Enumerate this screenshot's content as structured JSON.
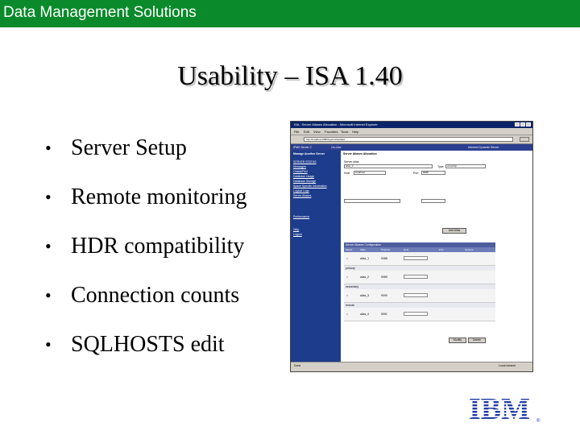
{
  "banner": {
    "text": "Data Management Solutions",
    "color": "#0a8a2a"
  },
  "slide": {
    "title": "Usability – ISA 1.40",
    "bullets": [
      "Server Setup",
      "Remote monitoring",
      "HDR compatibility",
      "Connection counts",
      "SQLHOSTS edit"
    ]
  },
  "logo": {
    "text": "IBM",
    "color": "#1f3aa8"
  },
  "screenshot": {
    "window_title": "ISA : Server Aliases Allocation - Microsoft Internet Explorer",
    "menu": [
      "File",
      "Edit",
      "View",
      "Favorites",
      "Tools",
      "Help"
    ],
    "address": "http://localhost:8080/cgi-bin/isa/alias",
    "header_left": "IFMX Server 2",
    "header_mid": "On-Line",
    "header_right": "Informix Dynamic Server",
    "sidebar_heading": "Manage Another Server",
    "sidebar_items": [
      "SERVER STATUS",
      "Messages",
      "Onstat/Perf",
      "Database Usage",
      "Database Storage",
      "Space Specific Information",
      "Logical Logs",
      "Server Aliases",
      "Performance",
      "Help",
      "Logout"
    ],
    "content_title": "Server Aliases Allocation",
    "field_labels": [
      "Server alias",
      "Type",
      "Host",
      "Port"
    ],
    "field_values": [
      "alias_2",
      "onsoctcp",
      "localhost",
      "9088"
    ],
    "add_button": "Add Alias",
    "table_title": "Server Aliases Configuration",
    "table_columns": [
      "Select",
      "Alias",
      "Protocol",
      "Host",
      "Port",
      "Options"
    ],
    "groups": [
      "primary",
      "secondary",
      "remote"
    ],
    "rows": [
      {
        "alias": "alias_1",
        "port": "9088"
      },
      {
        "alias": "alias_2",
        "port": "9089"
      },
      {
        "alias": "alias_3",
        "port": "9090"
      },
      {
        "alias": "alias_4",
        "port": "9091"
      }
    ],
    "modify_button": "Modify",
    "delete_button": "Delete",
    "status_left": "Done",
    "status_right": "Local intranet"
  }
}
